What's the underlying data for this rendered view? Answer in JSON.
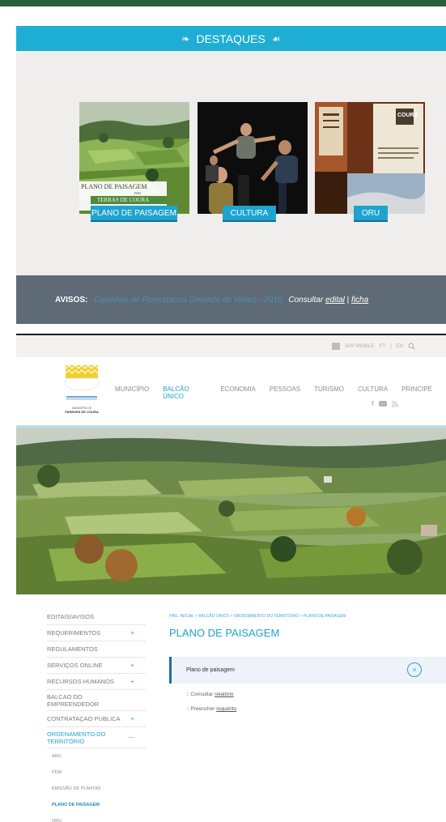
{
  "destaques": {
    "title": "DESTAQUES",
    "cards": [
      {
        "label": "PLANO DE PAISAGEM",
        "caption_line1": "PLANO DE PAISAGEM",
        "caption_line2": "DAS",
        "caption_line3": "TERRAS DE COURA"
      },
      {
        "label": "CULTURA"
      },
      {
        "label": "ORU",
        "photo_text": "COURA"
      }
    ]
  },
  "avisos": {
    "label": "AVISOS:",
    "text": "Cipriafeio de Flonestaccis Dourado do Valaro - 2016",
    "consult": "Consultar",
    "edital": "edital",
    "sep": "|",
    "ficha": "ficha"
  },
  "utility": {
    "app_mobile": "APP MOBILE",
    "lang_pt": "PT",
    "lang_sep": "|",
    "lang_en": "EN"
  },
  "logo": {
    "line1": "MUNICÍPIO DE",
    "line2": "PAREDES DE COURA"
  },
  "nav": {
    "items": [
      "MUNICÍPIO",
      "BALCÃO ÚNICO",
      "ECONOMIA",
      "PESSOAS",
      "TURISMO",
      "CULTURA",
      "PRINCIPE"
    ],
    "active_index": 1
  },
  "sidebar": {
    "items": [
      {
        "label": "EDITAIS/AVISOS",
        "plus": false
      },
      {
        "label": "REQUERIMENTOS",
        "plus": true
      },
      {
        "label": "REGULAMENTOS",
        "plus": false
      },
      {
        "label": "SERVIÇOS ONLINE",
        "plus": true
      },
      {
        "label": "RECURSOS HUMANOS",
        "plus": true
      },
      {
        "label": "BALCAO DO EMPREENDEDOR",
        "plus": false
      },
      {
        "label": "CONTRATAÇAO PUBLICA",
        "plus": true
      },
      {
        "label": "ORDENAMENTO DO TERRITÓRIO",
        "plus": false,
        "open": true
      }
    ],
    "open_symbol": "—",
    "plus_symbol": "+",
    "subitems": [
      "ARU",
      "PDM",
      "EMISSÃO DE PLANTAS",
      "PLANO DE PAISAGEM",
      "ORU"
    ],
    "current_sub": 3
  },
  "main": {
    "breadcrumb": "PÁG. INICIAL > BALCÃO ÚNICO > ORDENAMENTO DO TERRITÓRIO > PLANO DE PAISAGEM",
    "title": "PLANO DE PAISAGEM",
    "accordion_title": "Plano de paisagem",
    "items": [
      {
        "prefix": ":: Consultar",
        "link": "relatório"
      },
      {
        "prefix": ":: Preencher",
        "link": "inquérito"
      }
    ]
  },
  "colors": {
    "accent": "#1fa3cf",
    "top_strip": "#2a5e3c",
    "avisos_bg": "#5e6a75",
    "panel_bg": "#f0eeec"
  },
  "icons": [
    "leaf-icon",
    "phone-icon",
    "search-icon",
    "facebook-icon",
    "youtube-icon",
    "rss-icon",
    "close-circle-icon",
    "plus-icon"
  ]
}
